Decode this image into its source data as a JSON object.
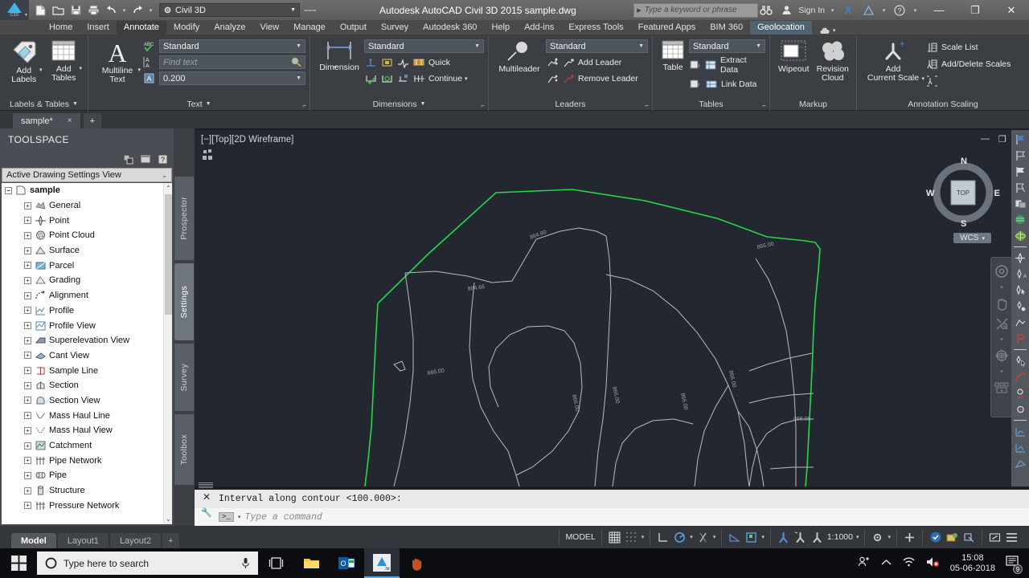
{
  "titlebar": {
    "app_title": "Autodesk AutoCAD Civil 3D 2015   sample.dwg",
    "workspace": "Civil 3D",
    "search_placeholder": "Type a keyword or phrase",
    "signin": "Sign In",
    "quick_access": [
      "new-icon",
      "open-icon",
      "save-icon",
      "plot-icon",
      "undo-icon",
      "redo-icon"
    ],
    "window_buttons": [
      "minimize",
      "restore",
      "close"
    ]
  },
  "ribbon_tabs": [
    {
      "label": "Home",
      "state": "normal"
    },
    {
      "label": "Insert",
      "state": "normal"
    },
    {
      "label": "Annotate",
      "state": "active"
    },
    {
      "label": "Modify",
      "state": "normal"
    },
    {
      "label": "Analyze",
      "state": "normal"
    },
    {
      "label": "View",
      "state": "normal"
    },
    {
      "label": "Manage",
      "state": "normal"
    },
    {
      "label": "Output",
      "state": "normal"
    },
    {
      "label": "Survey",
      "state": "normal"
    },
    {
      "label": "Autodesk 360",
      "state": "normal"
    },
    {
      "label": "Help",
      "state": "normal"
    },
    {
      "label": "Add-ins",
      "state": "normal"
    },
    {
      "label": "Express Tools",
      "state": "normal"
    },
    {
      "label": "Featured Apps",
      "state": "normal"
    },
    {
      "label": "BIM 360",
      "state": "normal"
    },
    {
      "label": "Geolocation",
      "state": "highlight"
    }
  ],
  "panels": {
    "labels_tables": {
      "title": "Labels & Tables",
      "buttons": [
        {
          "label_line1": "Add",
          "label_line2": "Labels",
          "icon": "label-tag-icon"
        },
        {
          "label_line1": "Add",
          "label_line2": "Tables",
          "icon": "table-grid-icon"
        }
      ]
    },
    "text": {
      "title": "Text",
      "big_button": {
        "label_line1": "Multiline",
        "label_line2": "Text",
        "icon": "letter-a-icon"
      },
      "style_combo": {
        "value": "Standard",
        "icon": "spellcheck-icon"
      },
      "find_field": {
        "placeholder": "Find text",
        "icon": "find-text-icon",
        "action_icon": "search-magnifier-icon"
      },
      "height_combo": {
        "value": "0.200",
        "icon": "text-height-icon"
      }
    },
    "dimensions": {
      "title": "Dimensions",
      "big_button": {
        "label": "Dimension",
        "icon": "linear-dimension-icon"
      },
      "style_combo": {
        "value": "Standard"
      },
      "row1": [
        {
          "icon": "dim-baseline-icon"
        },
        {
          "icon": "dim-update-icon"
        },
        {
          "icon": "dim-jogged-icon"
        },
        {
          "icon": "dim-quick-icon"
        }
      ],
      "row1_label": "Quick",
      "row2": [
        {
          "icon": "dim-check-icon"
        },
        {
          "icon": "dim-reassociate-icon"
        },
        {
          "icon": "dim-oblique-icon"
        },
        {
          "icon": "dim-continue-icon"
        }
      ],
      "row2_label": "Continue"
    },
    "leaders": {
      "title": "Leaders",
      "big_button": {
        "label": "Multileader",
        "icon": "multileader-icon"
      },
      "style_combo": {
        "value": "Standard"
      },
      "items": [
        {
          "label": "Add Leader",
          "icon": "add-leader-icon",
          "pre_icon": "align-leader-icon"
        },
        {
          "label": "Remove Leader",
          "icon": "remove-leader-icon",
          "pre_icon": "collect-leader-icon"
        }
      ]
    },
    "tables": {
      "title": "Tables",
      "big_button": {
        "label": "Table",
        "icon": "table-icon"
      },
      "style_combo": {
        "value": "Standard"
      },
      "items": [
        {
          "label": "Extract Data",
          "icon": "extract-data-icon",
          "pre_icon": "table-insert-icon"
        },
        {
          "label": "Link Data",
          "icon": "link-data-icon",
          "pre_icon": "table-download-icon"
        }
      ]
    },
    "markup": {
      "title": "Markup",
      "buttons": [
        {
          "label": "Wipeout",
          "icon": "wipeout-icon"
        },
        {
          "label_line1": "Revision",
          "label_line2": "Cloud",
          "icon": "revision-cloud-icon"
        }
      ]
    },
    "annotation_scaling": {
      "title": "Annotation Scaling",
      "big_button": {
        "label_line1": "Add",
        "label_line2": "Current Scale",
        "icon": "add-scale-icon"
      },
      "items": [
        {
          "label": "Scale List",
          "icon": "scale-list-icon"
        },
        {
          "label": "Add/Delete Scales",
          "icon": "add-delete-scales-icon"
        },
        {
          "label": "",
          "icon": "sync-scale-icon"
        }
      ]
    }
  },
  "file_tabs": [
    {
      "label": "sample*",
      "close": "×"
    },
    {
      "label": "+"
    }
  ],
  "toolspace": {
    "header": "TOOLSPACE",
    "tool_icons": [
      "toggle-panel-icon",
      "properties-icon",
      "help-icon"
    ],
    "view_selector": "Active Drawing Settings View",
    "tree_root": "sample",
    "tree_items": [
      {
        "label": "General",
        "icon": "general-icon"
      },
      {
        "label": "Point",
        "icon": "point-icon"
      },
      {
        "label": "Point Cloud",
        "icon": "point-cloud-icon"
      },
      {
        "label": "Surface",
        "icon": "surface-icon"
      },
      {
        "label": "Parcel",
        "icon": "parcel-icon"
      },
      {
        "label": "Grading",
        "icon": "grading-icon"
      },
      {
        "label": "Alignment",
        "icon": "alignment-icon"
      },
      {
        "label": "Profile",
        "icon": "profile-icon"
      },
      {
        "label": "Profile View",
        "icon": "profile-view-icon"
      },
      {
        "label": "Superelevation View",
        "icon": "superelevation-view-icon"
      },
      {
        "label": "Cant View",
        "icon": "cant-view-icon"
      },
      {
        "label": "Sample Line",
        "icon": "sample-line-icon"
      },
      {
        "label": "Section",
        "icon": "section-icon"
      },
      {
        "label": "Section View",
        "icon": "section-view-icon"
      },
      {
        "label": "Mass Haul Line",
        "icon": "mass-haul-line-icon"
      },
      {
        "label": "Mass Haul View",
        "icon": "mass-haul-view-icon"
      },
      {
        "label": "Catchment",
        "icon": "catchment-icon"
      },
      {
        "label": "Pipe Network",
        "icon": "pipe-network-icon"
      },
      {
        "label": "Pipe",
        "icon": "pipe-icon"
      },
      {
        "label": "Structure",
        "icon": "structure-icon"
      },
      {
        "label": "Pressure Network",
        "icon": "pressure-network-icon"
      }
    ],
    "vertical_tabs": [
      {
        "label": "Prospector",
        "active": false
      },
      {
        "label": "Settings",
        "active": true
      },
      {
        "label": "Survey",
        "active": false
      },
      {
        "label": "Toolbox",
        "active": false
      }
    ]
  },
  "drawing": {
    "viewport_label": "[−][Top][2D Wireframe]",
    "viewcube": {
      "top": "TOP",
      "north": "N",
      "south": "S",
      "east": "E",
      "west": "W"
    },
    "ucs_indicator": "WCS",
    "contour_labels": [
      "884.80",
      "884.66",
      "866.00",
      "866.00",
      "866.00",
      "866.00",
      "866.00"
    ],
    "boundary_color": "#27d64a",
    "contour_color": "#b6bcc4",
    "background_color": "#232830",
    "cursor": "pan-hand-icon"
  },
  "command_line": {
    "history": "Interval along contour <100.000>:",
    "input_placeholder": "Type a command",
    "prompt_symbol": ">_"
  },
  "status_bar": {
    "layout_tabs": [
      {
        "label": "Model",
        "active": true
      },
      {
        "label": "Layout1",
        "active": false
      },
      {
        "label": "Layout2",
        "active": false
      },
      {
        "label": "+",
        "active": false
      }
    ],
    "model_label": "MODEL",
    "scale": "1:1000",
    "toggles": [
      {
        "name": "grid-display-icon",
        "on": true
      },
      {
        "name": "snap-mode-icon",
        "on": false
      },
      {
        "name": "ortho-mode-icon",
        "on": false
      },
      {
        "name": "polar-tracking-icon",
        "on": true
      },
      {
        "name": "object-snap-icon",
        "on": false
      },
      {
        "name": "annotation-visibility-icon",
        "on": true
      },
      {
        "name": "autoscale-icon",
        "on": false
      },
      {
        "name": "workspace-switch-icon",
        "on": false
      },
      {
        "name": "hardware-accel-icon",
        "on": true
      },
      {
        "name": "isolate-objects-icon",
        "on": false
      },
      {
        "name": "fullscreen-icon",
        "on": false
      },
      {
        "name": "customization-icon",
        "on": false
      }
    ]
  },
  "taskbar": {
    "search_placeholder": "Type here to search",
    "start": "windows-start-icon",
    "items": [
      {
        "name": "task-view-icon"
      },
      {
        "name": "file-explorer-icon"
      },
      {
        "name": "outlook-icon"
      },
      {
        "name": "autocad-civil3d-icon",
        "active": true
      },
      {
        "name": "hand-app-icon"
      }
    ],
    "tray": [
      "people-icon",
      "show-hidden-icon",
      "wifi-icon",
      "volume-muted-icon"
    ],
    "clock_time": "15:08",
    "clock_date": "05-06-2018",
    "notification_count": "9"
  }
}
